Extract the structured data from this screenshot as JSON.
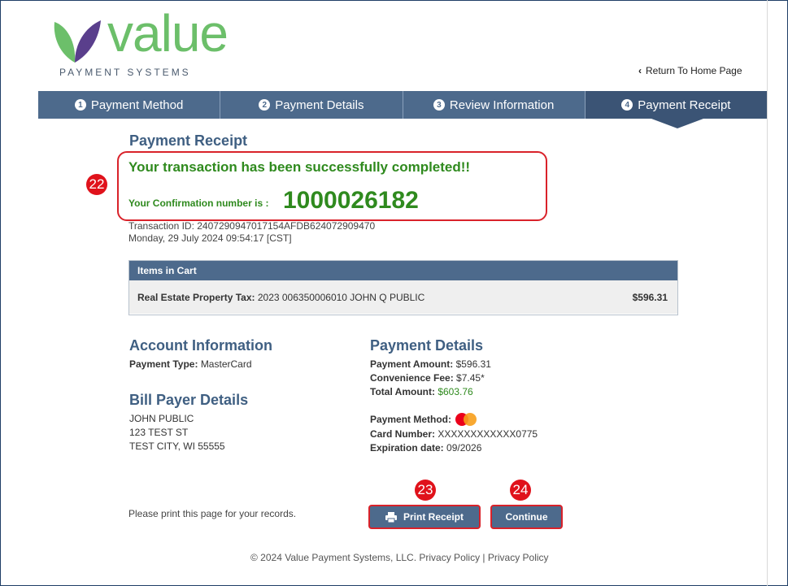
{
  "brand": {
    "name": "value",
    "subtitle": "PAYMENT SYSTEMS"
  },
  "nav": {
    "return_label": "Return To Home Page"
  },
  "steps": [
    {
      "num": "1",
      "label": "Payment Method"
    },
    {
      "num": "2",
      "label": "Payment Details"
    },
    {
      "num": "3",
      "label": "Review Information"
    },
    {
      "num": "4",
      "label": "Payment Receipt"
    }
  ],
  "receipt": {
    "title": "Payment Receipt",
    "success_message": "Your transaction has been successfully completed!!",
    "confirmation_label": "Your Confirmation number is :",
    "confirmation_number": "1000026182",
    "transaction_id": "Transaction ID: 2407290947017154AFDB624072909470",
    "timestamp": "Monday, 29 July 2024 09:54:17 [CST]"
  },
  "cart": {
    "header": "Items in Cart",
    "item_label": "Real Estate Property Tax:",
    "item_desc": "2023 006350006010 JOHN Q PUBLIC",
    "item_amount": "$596.31"
  },
  "account": {
    "title": "Account Information",
    "payment_type_label": "Payment Type:",
    "payment_type": "MasterCard"
  },
  "bill_payer": {
    "title": "Bill Payer Details",
    "name": "JOHN PUBLIC",
    "address1": "123 TEST ST",
    "address2": "TEST CITY, WI 55555"
  },
  "payment_details": {
    "title": "Payment Details",
    "amount_label": "Payment Amount:",
    "amount": "$596.31",
    "fee_label": "Convenience Fee:",
    "fee": "$7.45*",
    "total_label": "Total Amount:",
    "total": "$603.76",
    "method_label": "Payment Method:",
    "card_label": "Card Number:",
    "card": "XXXXXXXXXXXX0775",
    "exp_label": "Expiration date:",
    "exp": "09/2026"
  },
  "actions": {
    "print_note": "Please print this page for your records.",
    "print_label": "Print Receipt",
    "continue_label": "Continue"
  },
  "annotations": {
    "b22": "22",
    "b23": "23",
    "b24": "24"
  },
  "footer": {
    "text": "© 2024 Value Payment Systems, LLC. Privacy Policy | Privacy Policy"
  },
  "colors": {
    "accent": "#4d6a8c",
    "success": "#2f8a1e",
    "highlight": "#d9222a",
    "brand_green": "#6cbf6a"
  }
}
